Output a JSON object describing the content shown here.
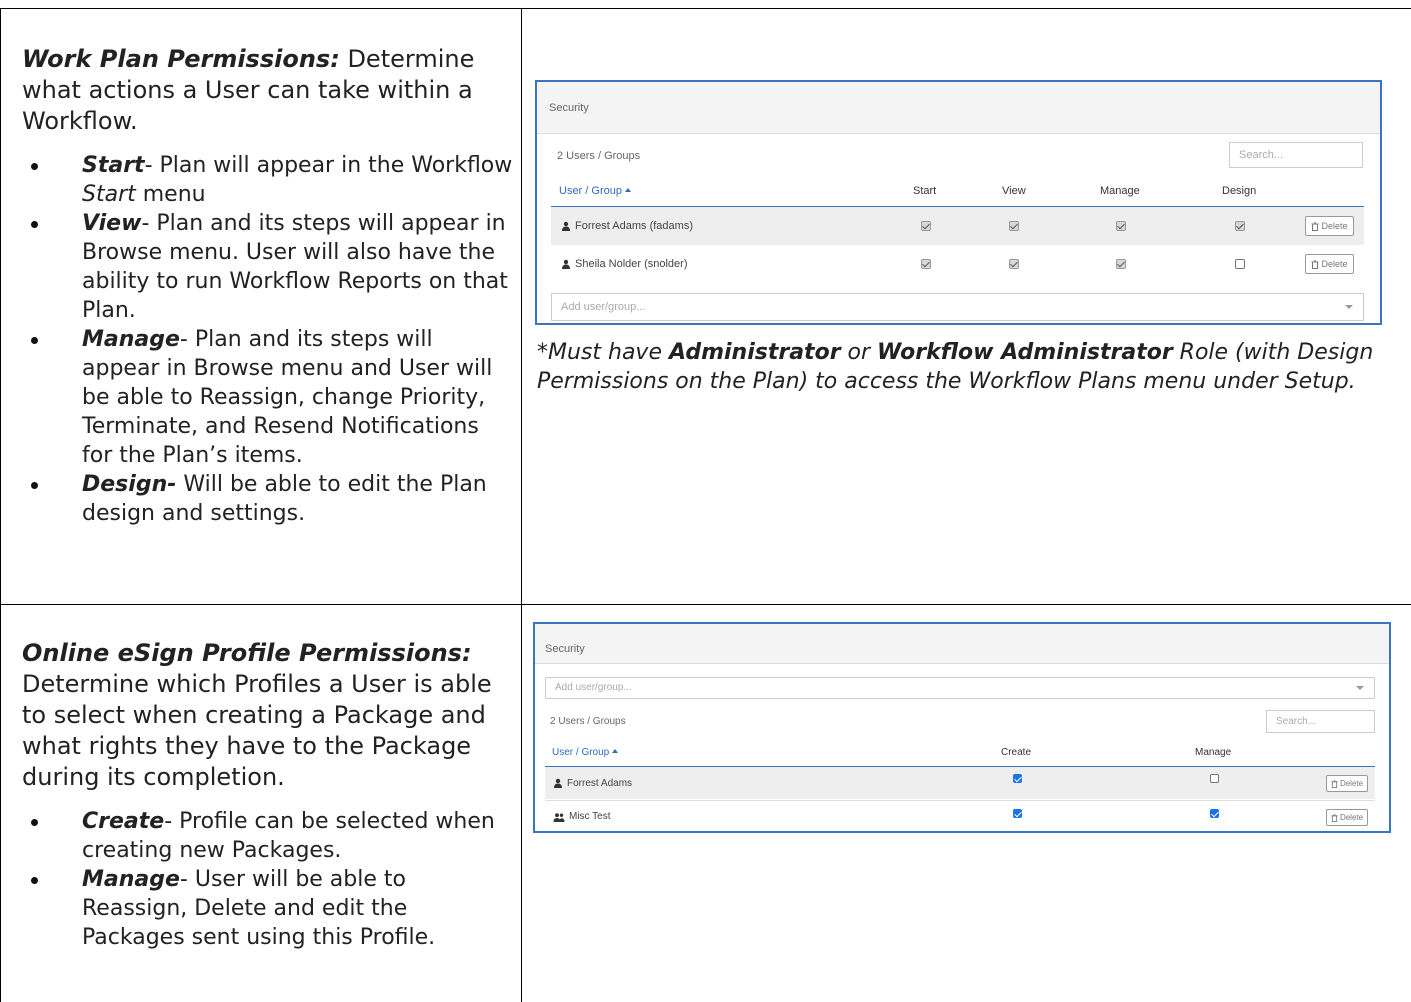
{
  "work_plan": {
    "title": "Work Plan Permissions:",
    "intro": "Determine what actions a User can take within a Workflow.",
    "bullets": [
      {
        "term": "Start",
        "text_before": "- Plan will appear in the Workflow ",
        "em": "Start",
        "text_after": " menu"
      },
      {
        "term": "View",
        "text": "- Plan and its steps will appear in Browse menu.  User will also have the ability to run Workflow Reports on that Plan."
      },
      {
        "term": "Manage",
        "text": "- Plan and its steps will appear in Browse menu and User will be able to Reassign, change Priority, Terminate, and Resend Notifications  for the Plan’s items."
      },
      {
        "term": "Design-",
        "text": " Will be able to edit the Plan design and settings."
      }
    ],
    "note": {
      "p1": "*Must have ",
      "b1": "Administrator",
      "p2": " or ",
      "b2": "Workflow Administrator",
      "p3": " Role (with Design Permissions on the Plan) to access the Workflow Plans menu under Setup."
    },
    "panel": {
      "header": "Security",
      "count": "2 Users / Groups",
      "search_placeholder": "Search...",
      "col_user": "User / Group",
      "columns": [
        "Start",
        "View",
        "Manage",
        "Design"
      ],
      "rows": [
        {
          "name": "Forrest Adams (fadams)",
          "checks": [
            true,
            true,
            true,
            true
          ],
          "delete": "Delete"
        },
        {
          "name": "Sheila Nolder (snolder)",
          "checks": [
            true,
            true,
            true,
            false
          ],
          "delete": "Delete"
        }
      ],
      "add_placeholder": "Add user/group..."
    }
  },
  "esign": {
    "title": "Online eSign Profile Permissions:",
    "intro": "Determine which Profiles a User is able to select when creating a Package and what rights they have to the Package during its completion.",
    "bullets": [
      {
        "term": "Create",
        "text": "- Profile can be selected when creating new Packages."
      },
      {
        "term": "Manage",
        "text": "- User will be able to Reassign, Delete and edit the Packages sent using this Profile."
      }
    ],
    "panel": {
      "header": "Security",
      "add_placeholder": "Add user/group...",
      "count": "2 Users / Groups",
      "search_placeholder": "Search...",
      "col_user": "User / Group",
      "columns": [
        "Create",
        "Manage"
      ],
      "rows": [
        {
          "name": "Forrest Adams",
          "type": "user",
          "checks": [
            true,
            false
          ],
          "delete": "Delete"
        },
        {
          "name": "Misc Test",
          "type": "group",
          "checks": [
            true,
            true
          ],
          "delete": "Delete"
        }
      ]
    }
  }
}
